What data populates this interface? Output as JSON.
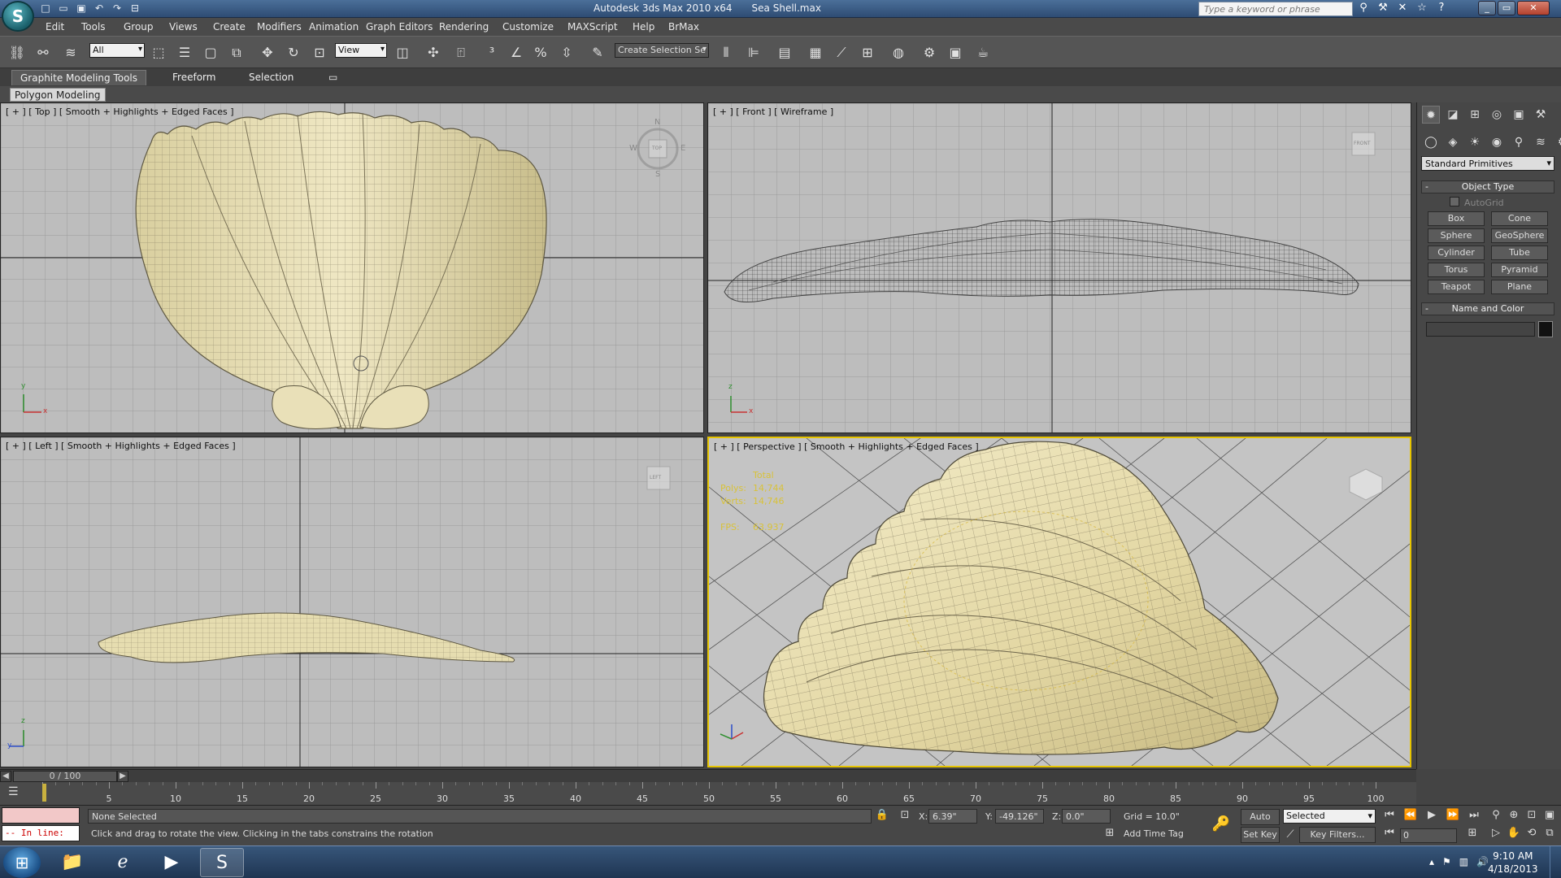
{
  "titlebar": {
    "app_title": "Autodesk 3ds Max  2010 x64",
    "file_name": "Sea Shell.max",
    "search_placeholder": "Type a keyword or phrase"
  },
  "menu": [
    "Edit",
    "Tools",
    "Group",
    "Views",
    "Create",
    "Modifiers",
    "Animation",
    "Graph Editors",
    "Rendering",
    "Customize",
    "MAXScript",
    "Help",
    "BrMax"
  ],
  "toolbar": {
    "filter_value": "All",
    "refcoord_value": "View",
    "named_selection_value": "Create Selection Se"
  },
  "ribbon": {
    "tabs": [
      "Graphite Modeling Tools",
      "Freeform",
      "Selection"
    ],
    "sub_tab": "Polygon Modeling"
  },
  "viewports": {
    "top": {
      "label": "[ + ] [ Top ] [ Smooth + Highlights + Edged Faces ]",
      "compass": [
        "N",
        "S",
        "W",
        "E"
      ],
      "cube": "TOP"
    },
    "front": {
      "label": "[ + ] [ Front ] [ Wireframe ]",
      "cube": "FRONT"
    },
    "left": {
      "label": "[ + ] [ Left ] [ Smooth + Highlights + Edged Faces ]",
      "cube": "LEFT"
    },
    "perspective": {
      "label": "[ + ] [ Perspective ] [ Smooth + Highlights + Edged Faces ]",
      "stats": {
        "header": "Total",
        "polys_label": "Polys:",
        "polys": "14,744",
        "verts_label": "Verts:",
        "verts": "14,746",
        "fps_label": "FPS:",
        "fps": "63.937"
      }
    }
  },
  "command_panel": {
    "dropdown": "Standard Primitives",
    "object_type_title": "Object Type",
    "autogrid": "AutoGrid",
    "buttons": [
      "Box",
      "Cone",
      "Sphere",
      "GeoSphere",
      "Cylinder",
      "Tube",
      "Torus",
      "Pyramid",
      "Teapot",
      "Plane"
    ],
    "name_color_title": "Name and Color"
  },
  "timeline": {
    "frame_display": "0 / 100",
    "ticks": [
      "5",
      "10",
      "15",
      "20",
      "25",
      "30",
      "35",
      "40",
      "45",
      "50",
      "55",
      "60",
      "65",
      "70",
      "75",
      "80",
      "85",
      "90",
      "95",
      "100"
    ]
  },
  "status": {
    "in_line": "-- In line:",
    "selection": "None Selected",
    "prompt": "Click and drag to rotate the view.  Clicking in the tabs constrains the rotation",
    "x_label": "X:",
    "x": "6.39\"",
    "y_label": "Y:",
    "y": "-49.126\"",
    "z_label": "Z:",
    "z": "0.0\"",
    "grid": "Grid = 10.0\"",
    "add_time_tag": "Add Time Tag",
    "auto_key": "Auto Key",
    "set_key": "Set Key",
    "key_mode": "Selected",
    "key_filters": "Key Filters...",
    "current_frame": "0"
  },
  "taskbar": {
    "time": "9:10 AM",
    "date": "4/18/2013"
  },
  "colors": {
    "shell": "#e6ddb0",
    "active_border": "#e6c400",
    "stats": "#d8c23a"
  }
}
